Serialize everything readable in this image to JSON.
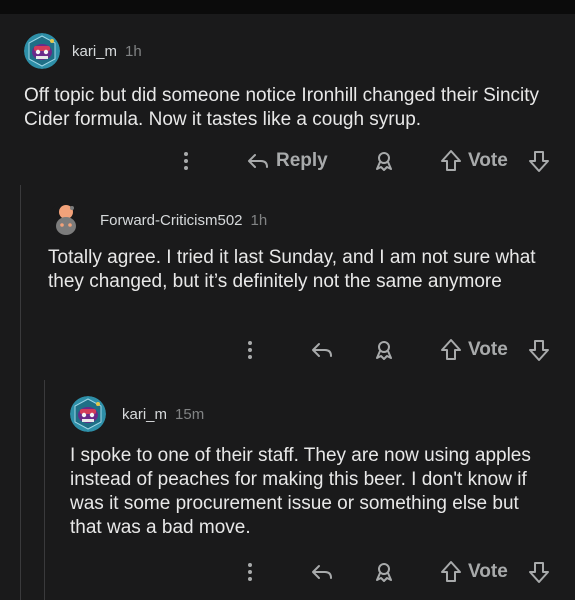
{
  "comments": [
    {
      "username": "kari_m",
      "time": "1h",
      "avatar": "robot-avatar-icon",
      "body": "Off topic but did someone notice Ironhill changed their Sincity Cider formula. Now it tastes like a cough syrup.",
      "reply_label": "Reply",
      "vote_label": "Vote"
    },
    {
      "username": "Forward-Criticism502",
      "time": "1h",
      "avatar": "snoo-default-avatar-icon",
      "body": "Totally agree. I tried it last Sunday, and I am not sure what they changed, but it’s definitely not the same anymore",
      "vote_label": "Vote"
    },
    {
      "username": "kari_m",
      "time": "15m",
      "avatar": "robot-avatar-icon",
      "body": "I spoke to one of their staff. They are now using apples instead of peaches for making this beer. I don't know if was it some procurement issue or something else but that was a bad move.",
      "vote_label": "Vote"
    }
  ],
  "colors": {
    "background": "#1a1a1b",
    "text": "#e8e8e8",
    "muted": "#818384",
    "icon": "#a8aaab",
    "avatar_teal": "#2e8fa8",
    "avatar_purple": "#6a2a8a"
  }
}
